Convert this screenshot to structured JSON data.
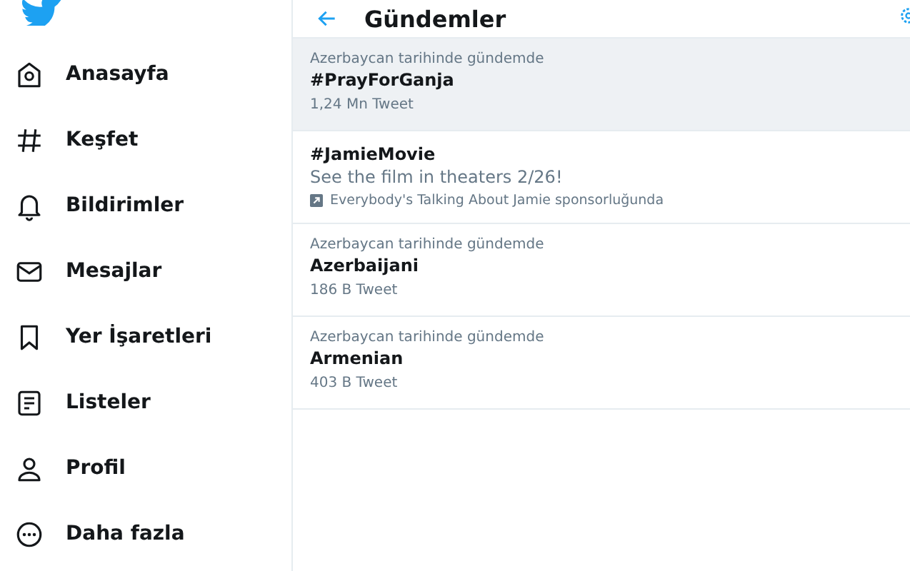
{
  "sidebar": {
    "items": [
      {
        "label": "Anasayfa"
      },
      {
        "label": "Keşfet"
      },
      {
        "label": "Bildirimler"
      },
      {
        "label": "Mesajlar"
      },
      {
        "label": "Yer İşaretleri"
      },
      {
        "label": "Listeler"
      },
      {
        "label": "Profil"
      },
      {
        "label": "Daha fazla"
      }
    ]
  },
  "header": {
    "title": "Gündemler"
  },
  "trends": [
    {
      "kind": "trend",
      "highlighted": true,
      "context": "Azerbaycan tarihinde gündemde",
      "name": "#PrayForGanja",
      "count": "1,24 Mn Tweet"
    },
    {
      "kind": "promoted",
      "highlighted": false,
      "name": "#JamieMovie",
      "description": "See the film in theaters 2/26!",
      "sponsor": "Everybody's Talking About Jamie sponsorluğunda"
    },
    {
      "kind": "trend",
      "highlighted": false,
      "context": "Azerbaycan tarihinde gündemde",
      "name": "Azerbaijani",
      "count": "186 B Tweet"
    },
    {
      "kind": "trend",
      "highlighted": false,
      "context": "Azerbaycan tarihinde gündemde",
      "name": "Armenian",
      "count": "403 B Tweet"
    }
  ]
}
